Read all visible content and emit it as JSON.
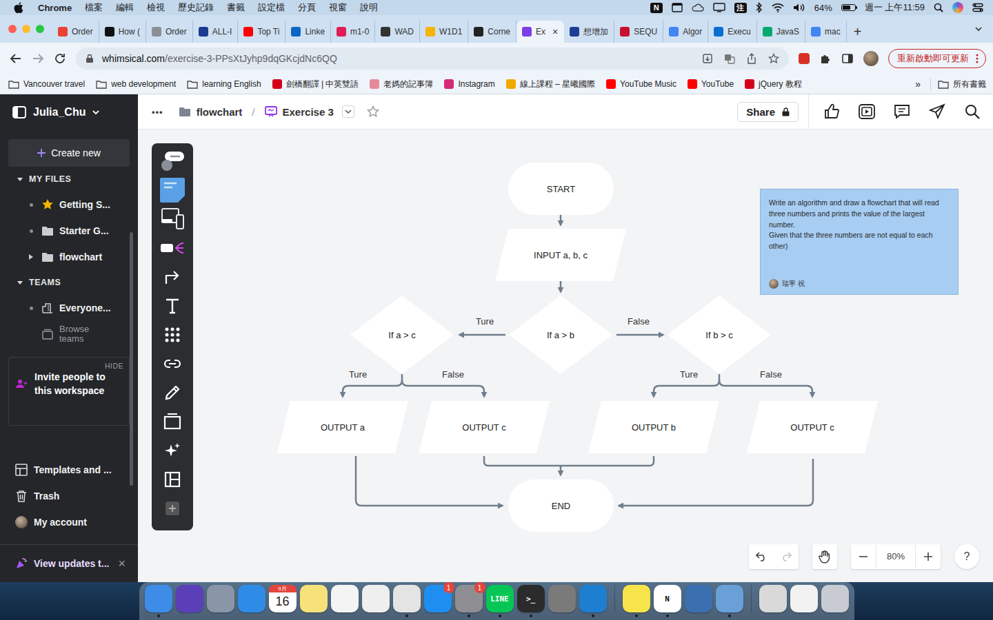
{
  "menubar": {
    "app": "Chrome",
    "menus": [
      "檔案",
      "編輯",
      "檢視",
      "歷史記錄",
      "書籤",
      "設定檔",
      "分頁",
      "視窗",
      "說明"
    ],
    "status_glyphs": [
      "N",
      "注"
    ],
    "battery": "64%",
    "battery_level": 0.64,
    "clock": "週一 上午11:59"
  },
  "tabs": {
    "items": [
      {
        "label": "Order",
        "selected": false,
        "color": "#ea4335"
      },
      {
        "label": "How (",
        "selected": false,
        "color": "#111111"
      },
      {
        "label": "Order",
        "selected": false,
        "color": "#8a8f96"
      },
      {
        "label": "ALL-I",
        "selected": false,
        "color": "#1a3b8f"
      },
      {
        "label": "Top Ti",
        "selected": false,
        "color": "#ff0000"
      },
      {
        "label": "Linke",
        "selected": false,
        "color": "#0a66c2"
      },
      {
        "label": "m1-0",
        "selected": false,
        "color": "#e01e5a"
      },
      {
        "label": "WAD",
        "selected": false,
        "color": "#333333"
      },
      {
        "label": "W1D1",
        "selected": false,
        "color": "#f4b400"
      },
      {
        "label": "Corne",
        "selected": false,
        "color": "#222222"
      },
      {
        "label": "Ex",
        "selected": true,
        "color": "#7b3fe4"
      },
      {
        "label": "想增加",
        "selected": false,
        "color": "#1c3f94"
      },
      {
        "label": "SEQU",
        "selected": false,
        "color": "#c8102e"
      },
      {
        "label": "Algor",
        "selected": false,
        "color": "#4285f4"
      },
      {
        "label": "Execu",
        "selected": false,
        "color": "#0a6ed1"
      },
      {
        "label": "JavaS",
        "selected": false,
        "color": "#04aa6d"
      },
      {
        "label": "mac",
        "selected": false,
        "color": "#4285f4"
      }
    ],
    "close": "×",
    "new_tab": "+"
  },
  "address": {
    "host": "whimsical.com",
    "path": "/exercise-3-PPsXtJyhp9dqGKcjdNc6QQ",
    "update_button": "重新啟動即可更新"
  },
  "bookmarks": {
    "items": [
      {
        "label": "Vancouver travel",
        "kind": "folder"
      },
      {
        "label": "web development",
        "kind": "folder"
      },
      {
        "label": "learning English",
        "kind": "folder"
      },
      {
        "label": "劍橋翻譯 | 中英雙語",
        "kind": "site",
        "color": "#d6001c"
      },
      {
        "label": "老媽的記事簿",
        "kind": "site",
        "color": "#e58a9a"
      },
      {
        "label": "Instagram",
        "kind": "site",
        "color": "#d62976"
      },
      {
        "label": "線上課程 – 星曦國際",
        "kind": "site",
        "color": "#f2a900"
      },
      {
        "label": "YouTube Music",
        "kind": "site",
        "color": "#ff0000"
      },
      {
        "label": "YouTube",
        "kind": "site",
        "color": "#ff0000"
      },
      {
        "label": "jQuery 教程",
        "kind": "site",
        "color": "#d6001c"
      }
    ],
    "more": "»",
    "all": "所有書籤"
  },
  "sidebar": {
    "workspace": "Julia_Chu",
    "create": "Create new",
    "sections": [
      {
        "title": "MY FILES",
        "expanded": true,
        "items": [
          {
            "label": "Getting S...",
            "kind": "starred",
            "expandable": false
          },
          {
            "label": "Starter G...",
            "kind": "folder",
            "expandable": false
          },
          {
            "label": "flowchart",
            "kind": "folder",
            "expandable": true
          }
        ]
      },
      {
        "title": "TEAMS",
        "expanded": true,
        "items": [
          {
            "label": "Everyone...",
            "kind": "team",
            "expandable": false
          },
          {
            "label": "Browse teams",
            "kind": "browse",
            "expandable": false
          }
        ]
      }
    ],
    "invite": {
      "hide": "HIDE",
      "text": "Invite people to this workspace"
    },
    "links": [
      {
        "label": "Templates and ...",
        "kind": "templates"
      },
      {
        "label": "Trash",
        "kind": "trash"
      },
      {
        "label": "My account",
        "kind": "account"
      }
    ],
    "updates": {
      "label": "View updates t...",
      "close": "×"
    }
  },
  "header": {
    "more": "•••",
    "folder": "flowchart",
    "separator": "/",
    "board": "Exercise 3",
    "share": "Share"
  },
  "flowchart": {
    "nodes": [
      {
        "label": "START",
        "kind": "terminal"
      },
      {
        "label": "INPUT a, b, c",
        "kind": "io"
      },
      {
        "label": "If a > b",
        "kind": "decision"
      },
      {
        "label": "If a > c",
        "kind": "decision"
      },
      {
        "label": "If b > c",
        "kind": "decision"
      },
      {
        "label": "OUTPUT a",
        "kind": "io"
      },
      {
        "label": "OUTPUT c",
        "kind": "io"
      },
      {
        "label": "OUTPUT b",
        "kind": "io"
      },
      {
        "label": "OUTPUT c",
        "kind": "io"
      },
      {
        "label": "END",
        "kind": "terminal"
      }
    ],
    "edge_labels": [
      "Ture",
      "False",
      "Ture",
      "False",
      "Ture",
      "False"
    ]
  },
  "note": {
    "text": "Write an algorithm and draw a flowchart that will read three numbers and prints the value of the largest number.\nGiven that the three numbers are not equal to each other)",
    "author": "瑞寧 祝"
  },
  "zoom": {
    "level": "80%",
    "help": "?"
  },
  "dock": {
    "items": [
      {
        "kind": "app",
        "color": "#3d8de8",
        "running": true
      },
      {
        "kind": "app",
        "color": "#5b3fb8",
        "running": false
      },
      {
        "kind": "app",
        "color": "#8a96a8",
        "running": false
      },
      {
        "kind": "app",
        "color": "#2f8ce6",
        "running": false
      },
      {
        "kind": "calendar",
        "color": "#ffffff",
        "month": "9月",
        "day": "16",
        "running": false
      },
      {
        "kind": "app",
        "color": "#f7e27a",
        "running": false
      },
      {
        "kind": "app",
        "color": "#f4f4f4",
        "running": false
      },
      {
        "kind": "app",
        "color": "#efefef",
        "running": false
      },
      {
        "kind": "app",
        "color": "#e4e4e4",
        "running": true
      },
      {
        "kind": "app",
        "color": "#1f8ef1",
        "running": false,
        "badge": "1"
      },
      {
        "kind": "app",
        "color": "#8e8e93",
        "running": true,
        "badge": "1"
      },
      {
        "kind": "glyph",
        "color": "#06c755",
        "glyph": "LINE",
        "running": true
      },
      {
        "kind": "glyph",
        "color": "#2b2b2b",
        "glyph": ">_",
        "running": true
      },
      {
        "kind": "app",
        "color": "#7a7a7a",
        "running": false
      },
      {
        "kind": "app",
        "color": "#1e7fd0",
        "running": true
      },
      {
        "kind": "separator"
      },
      {
        "kind": "app",
        "color": "#f7e44a",
        "running": true
      },
      {
        "kind": "glyph",
        "color": "#ffffff",
        "glyph": "N",
        "running": true
      },
      {
        "kind": "app",
        "color": "#3a6fb0",
        "running": false
      },
      {
        "kind": "app",
        "color": "#6aa0d8",
        "running": true
      },
      {
        "kind": "separator"
      },
      {
        "kind": "app",
        "color": "#d9d9d9",
        "running": false
      },
      {
        "kind": "app",
        "color": "#f2f2f2",
        "running": false
      },
      {
        "kind": "app",
        "color": "#c8ccd2",
        "running": false
      }
    ]
  }
}
